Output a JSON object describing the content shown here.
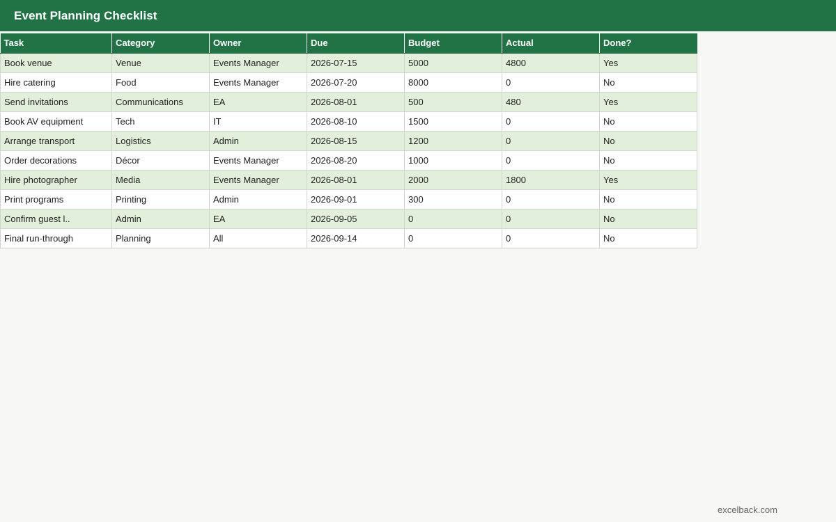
{
  "title": "Event Planning Checklist",
  "columns": [
    "Task",
    "Category",
    "Owner",
    "Due",
    "Budget",
    "Actual",
    "Done?"
  ],
  "rows": [
    [
      "Book venue",
      "Venue",
      "Events Manager",
      "2026-07-15",
      "5000",
      "4800",
      "Yes"
    ],
    [
      "Hire catering",
      "Food",
      "Events Manager",
      "2026-07-20",
      "8000",
      "0",
      "No"
    ],
    [
      "Send invitations",
      "Communications",
      "EA",
      "2026-08-01",
      "500",
      "480",
      "Yes"
    ],
    [
      "Book AV equipment",
      "Tech",
      "IT",
      "2026-08-10",
      "1500",
      "0",
      "No"
    ],
    [
      "Arrange transport",
      "Logistics",
      "Admin",
      "2026-08-15",
      "1200",
      "0",
      "No"
    ],
    [
      "Order decorations",
      "Décor",
      "Events Manager",
      "2026-08-20",
      "1000",
      "0",
      "No"
    ],
    [
      "Hire photographer",
      "Media",
      "Events Manager",
      "2026-08-01",
      "2000",
      "1800",
      "Yes"
    ],
    [
      "Print programs",
      "Printing",
      "Admin",
      "2026-09-01",
      "300",
      "0",
      "No"
    ],
    [
      "Confirm guest l..",
      "Admin",
      "EA",
      "2026-09-05",
      "0",
      "0",
      "No"
    ],
    [
      "Final run-through",
      "Planning",
      "All",
      "2026-09-14",
      "0",
      "0",
      "No"
    ]
  ],
  "footer": "excelback.com",
  "colors": {
    "header_green": "#217346",
    "band_green": "#e2efda"
  }
}
